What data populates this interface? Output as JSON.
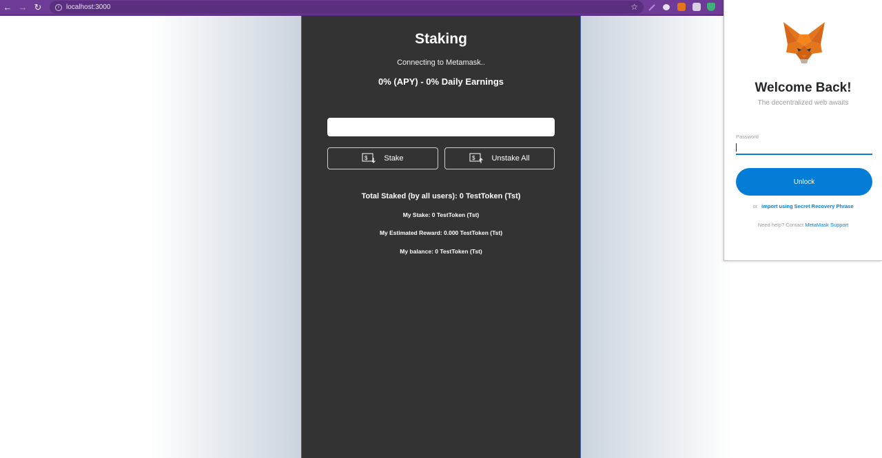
{
  "browser": {
    "url": "localhost:3000",
    "nav_back": "←",
    "nav_forward": "→",
    "nav_reload": "↻",
    "info": "i",
    "star": "☆",
    "toolbar_color": "#6e3c97"
  },
  "staking": {
    "title": "Staking",
    "status": "Connecting to Metamask..",
    "apy_text": "0% (APY) - 0% Daily Earnings",
    "amount_value": "",
    "stake_label": "Stake",
    "unstake_label": "Unstake All",
    "stats": {
      "total_staked": "Total Staked (by all users): 0 TestToken (Tst)",
      "my_stake": "My Stake: 0 TestToken (Tst)",
      "my_reward": "My Estimated Reward: 0.000 TestToken (Tst)",
      "my_balance": "My balance: 0 TestToken (Tst)"
    },
    "panel_color": "#333333"
  },
  "metamask": {
    "welcome": "Welcome Back!",
    "tagline": "The decentralized web awaits",
    "password_label": "Password",
    "password_value": "",
    "unlock_label": "Unlock",
    "or_text": "or",
    "import_link": "import using Secret Recovery Phrase",
    "help_text": "Need help? Contact",
    "help_link": "MetaMask Support",
    "accent_color": "#037dd6"
  }
}
